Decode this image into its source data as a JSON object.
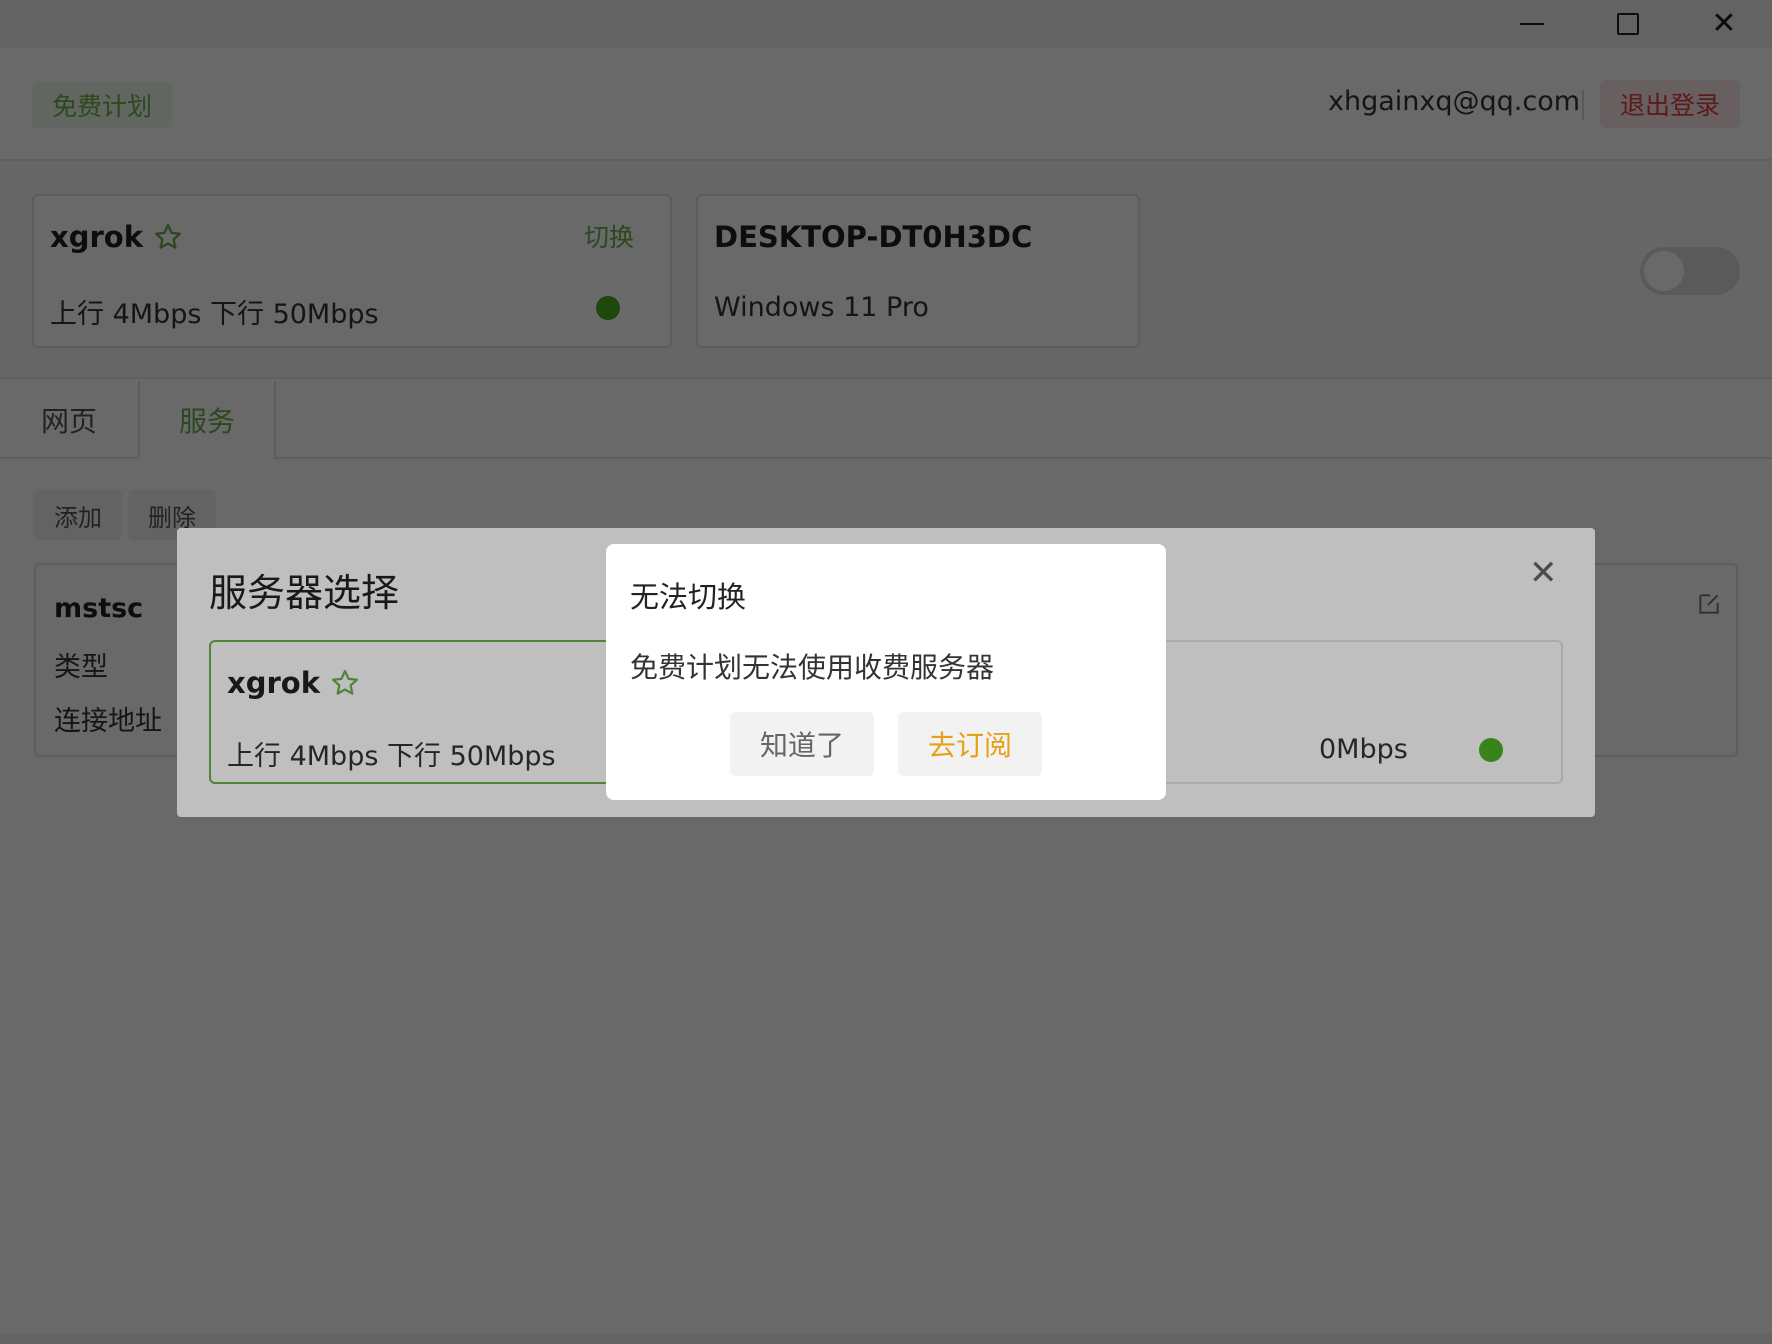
{
  "window": {
    "minimize_icon": "minimize-icon",
    "maximize_icon": "maximize-icon",
    "close_icon": "close-icon"
  },
  "header": {
    "plan": "免费计划",
    "email": "xhgainxq@qq.com",
    "logout": "退出登录"
  },
  "current_server": {
    "name": "xgrok",
    "speed": "上行 4Mbps 下行 50Mbps",
    "switch_label": "切换",
    "status_color": "#4caf24"
  },
  "device": {
    "name": "DESKTOP-DT0H3DC",
    "os": "Windows 11 Pro"
  },
  "tabs": {
    "web": "网页",
    "service": "服务"
  },
  "actions": {
    "add": "添加",
    "delete": "删除"
  },
  "service": {
    "name": "mstsc",
    "type_label": "类型",
    "address_label": "连接地址"
  },
  "server_modal": {
    "title": "服务器选择",
    "cards": [
      {
        "name": "xgrok",
        "speed": "上行 4Mbps 下行 50Mbps"
      },
      {
        "speed_partial": "0Mbps"
      }
    ]
  },
  "alert": {
    "title": "无法切换",
    "message": "免费计划无法使用收费服务器",
    "ok": "知道了",
    "subscribe": "去订阅"
  },
  "colors": {
    "accent_green": "#6ab04c",
    "danger": "#e04040",
    "warning_orange": "#e6a017"
  }
}
